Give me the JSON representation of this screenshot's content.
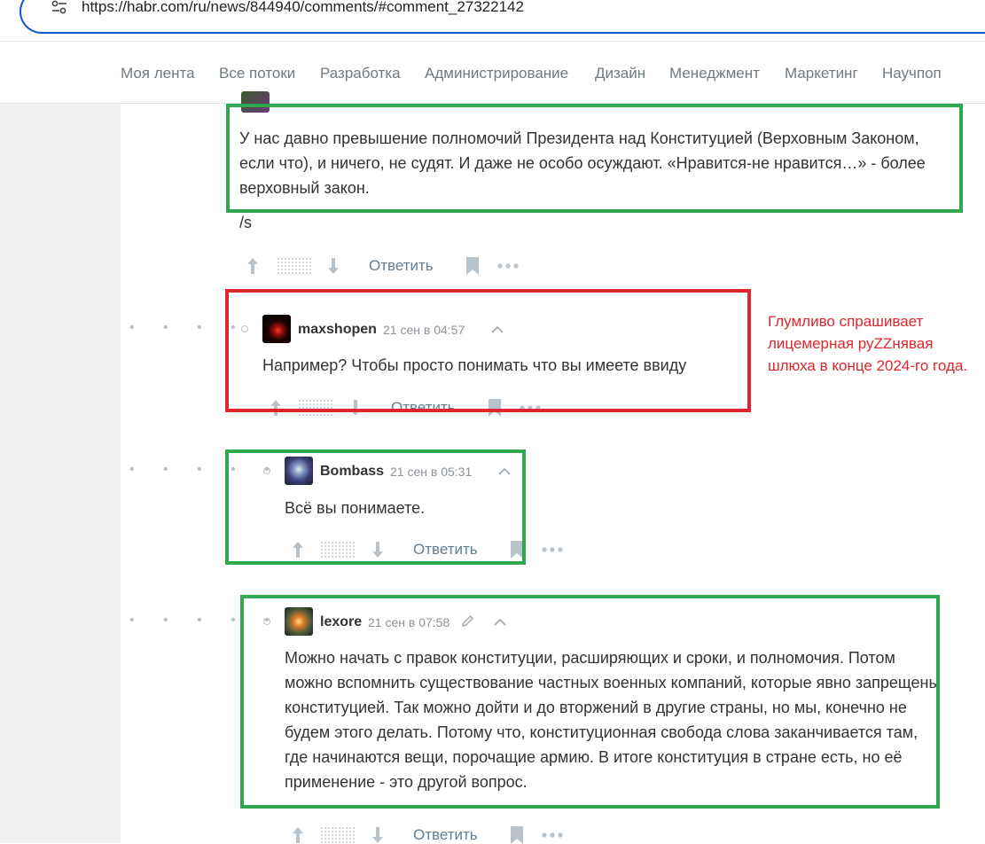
{
  "browser": {
    "url": "https://habr.com/ru/news/844940/comments/#comment_27322142"
  },
  "nav": {
    "items": [
      "Моя лента",
      "Все потоки",
      "Разработка",
      "Администрирование",
      "Дизайн",
      "Менеджмент",
      "Маркетинг",
      "Научпоп"
    ]
  },
  "comments": [
    {
      "text": "У нас давно превышение полномочий Президента над Конституцией (Верховным Законом, если что), и ничего, не судят. И даже не особо осуждают. «Нравится-не нравится…» - более верховный закон.",
      "extra": "/s",
      "reply": "Ответить"
    },
    {
      "author": "maxshopen",
      "date": "21 сен в 04:57",
      "text": "Например? Чтобы просто понимать что вы имеете ввиду",
      "reply": "Ответить"
    },
    {
      "author": "Bombass",
      "date": "21 сен в 05:31",
      "text": "Всё вы понимаете.",
      "reply": "Ответить"
    },
    {
      "author": "lexore",
      "date": "21 сен в 07:58",
      "text": "Можно начать с правок конституции, расширяющих и сроки, и полномочия. Потом можно вспомнить существование частных военных компаний, которые явно запрещены конституцией. Так можно дойти и до вторжений в другие страны, но мы, конечно не будем этого делать. Потому что, конституционная свобода слова заканчивается там, где начинаются вещи, порочащие армию. В итоге конституция в стране есть, но её применение - это другой вопрос.",
      "reply": "Ответить"
    }
  ],
  "annotation": "Глумливо спрашивает лицемерная руZZнявая шлюха в конце 2024-го года.",
  "colors": {
    "highlight_good": "#2fa84f",
    "highlight_bad": "#e0262d",
    "link": "#5e7f96"
  },
  "icons": [
    "tune-icon",
    "upvote-icon",
    "downvote-icon",
    "bookmark-icon",
    "more-icon",
    "chevron-up-icon",
    "edit-icon"
  ]
}
